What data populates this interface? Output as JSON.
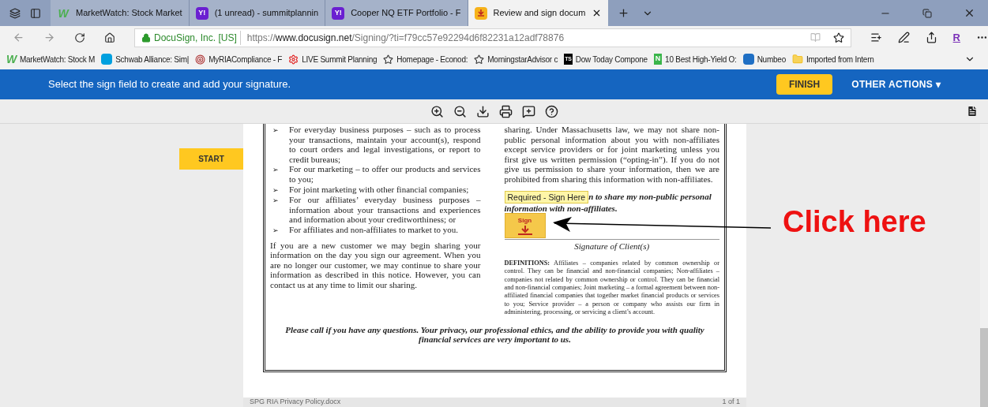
{
  "browser": {
    "tabs": [
      {
        "title": "MarketWatch: Stock Market",
        "kind": "letter",
        "logo": "W",
        "selected": false
      },
      {
        "title": "(1 unread) - summitplannin",
        "kind": "badge",
        "logo": "Y!",
        "selected": false
      },
      {
        "title": "Cooper NQ ETF Portfolio - F",
        "kind": "badge",
        "logo": "Y!",
        "selected": false
      },
      {
        "title": "Review and sign docum",
        "kind": "download",
        "selected": true
      }
    ],
    "site_identity": "DocuSign, Inc. [US]",
    "url_prefix": "https://",
    "url_domain": "www.docusign.net",
    "url_path": "/Signing/?ti=f79cc57e92294d6f82231a12adf78876",
    "profile_letter": "R",
    "favorites": [
      {
        "label": "MarketWatch: Stock M",
        "kind": "letter",
        "logo": "W"
      },
      {
        "label": "Schwab Alliance: Sim|",
        "kind": "square"
      },
      {
        "label": "MyRIACompliance - F",
        "kind": "target"
      },
      {
        "label": "LIVE Summit Planning",
        "kind": "gear"
      },
      {
        "label": "Homepage - Econod:",
        "kind": "star"
      },
      {
        "label": "MorningstarAdvisor c",
        "kind": "star"
      },
      {
        "label": "Dow Today Compone",
        "kind": "badge",
        "logo": "TS"
      },
      {
        "label": "10 Best High-Yield O:",
        "kind": "badge",
        "logo": "N"
      },
      {
        "label": "Numbeo",
        "kind": "square"
      },
      {
        "label": "Imported from Intern",
        "kind": "folder"
      }
    ]
  },
  "banner": {
    "message": "Select the sign field to create and add your signature.",
    "finish": "FINISH",
    "other_actions": "OTHER ACTIONS ▾"
  },
  "start_button": "START",
  "document": {
    "left_bullets": [
      {
        "marker": "➢",
        "text": "For everyday business purposes – such as to process your transactions, maintain your account(s), respond to court orders and legal investigations, or report to credit bureaus;"
      },
      {
        "marker": "➢",
        "text": "For our marketing – to offer our products and services to you;"
      },
      {
        "marker": "➢",
        "text": "For joint marketing with other financial companies;"
      },
      {
        "marker": "➢",
        "text": "For our affiliates’ everyday business purposes – information about your transactions and experiences and information about your creditworthiness; or"
      },
      {
        "marker": "➢",
        "text": "For affiliates and non-affiliates to market to you."
      }
    ],
    "left_paragraph": "If you are a new customer we may begin sharing your information on the day you sign our agreement. When you are no longer our customer, we may continue to share your information as described in this notice. However, you can contact us at any time to limit our sharing.",
    "right_paragraph": "sharing. Under Massachusetts law, we may not share non-public personal information about you with non-affiliates except service providers or for joint marketing unless you first give us written permission (“opting-in”). If you do not give us permission to share your information, then we are prohibited from sharing this information with non-affiliates.",
    "sign_tag": "Required - Sign Here",
    "consent_line_1": "n to share my non-public personal",
    "consent_line_2": "information with non-affiliates.",
    "sign_field": "Sign",
    "signature_caption": "Signature of Client(s)",
    "definitions": "**DEFINITIONS:** Affiliates – companies related by common ownership or control. They can be financial and non-financial companies; Non-affiliates – companies not related by common ownership or control. They can be financial and non-financial companies; Joint marketing – a formal agreement between non-affiliated financial companies that together market financial products or services to you; Service provider – a person or company who assists our firm in administering, processing, or servicing a client’s account.",
    "closing": "Please call if you have any questions. Your privacy, our professional ethics, and the ability to provide you with quality financial services are very important to us."
  },
  "callout": "Click here",
  "footer": {
    "filename": "SPG RIA Privacy Policy.docx",
    "pages": "1 of 1"
  }
}
